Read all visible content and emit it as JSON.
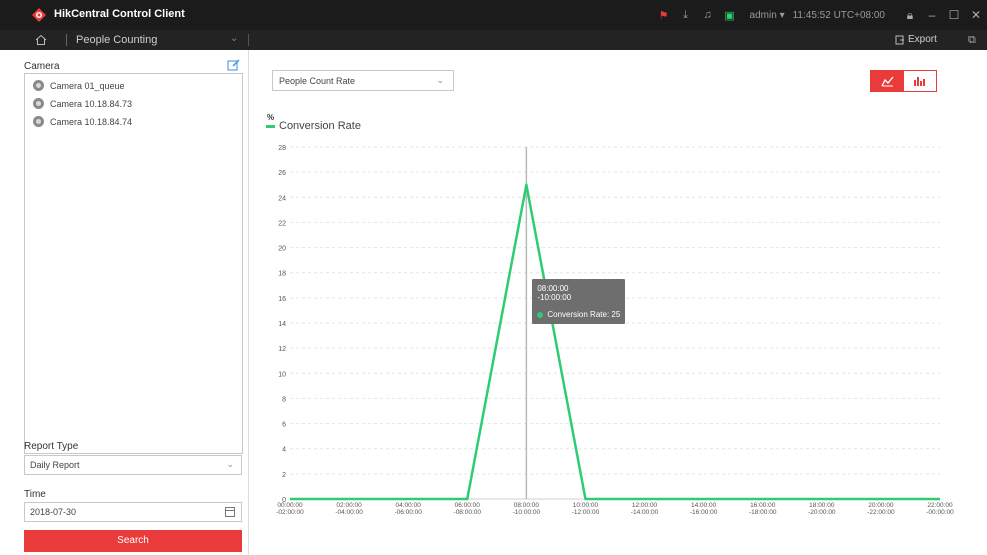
{
  "app": {
    "title": "HikCentral Control Client",
    "user": "admin",
    "time": "11:45:52 UTC+08:00",
    "brand_color": "#e83a3a"
  },
  "nav": {
    "module": "People Counting",
    "export_label": "Export"
  },
  "left": {
    "camera_label": "Camera",
    "cameras": [
      {
        "name": "Camera 01_queue"
      },
      {
        "name": "Camera 10.18.84.73"
      },
      {
        "name": "Camera 10.18.84.74"
      }
    ],
    "report_type_label": "Report Type",
    "report_type_value": "Daily Report",
    "time_label": "Time",
    "time_value": "2018-07-30",
    "search_label": "Search"
  },
  "main": {
    "metric_select_value": "People Count Rate",
    "view_mode": "line"
  },
  "chart_data": {
    "type": "line",
    "ylabel": "%",
    "ylim": [
      0,
      28
    ],
    "yticks": [
      0,
      2,
      4,
      6,
      8,
      10,
      12,
      14,
      16,
      18,
      20,
      22,
      24,
      26,
      28
    ],
    "categories": [
      "00:00:00 -02:00:00",
      "02:00:00 -04:00:00",
      "04:00:00 -06:00:00",
      "06:00:00 -08:00:00",
      "08:00:00 -10:00:00",
      "10:00:00 -12:00:00",
      "12:00:00 -14:00:00",
      "14:00:00 -16:00:00",
      "16:00:00 -18:00:00",
      "18:00:00 -20:00:00",
      "20:00:00 -22:00:00",
      "22:00:00 -00:00:00"
    ],
    "series": [
      {
        "name": "Conversion Rate",
        "color": "#2fcc71",
        "values": [
          0,
          0,
          0,
          0,
          25,
          0,
          0,
          0,
          0,
          0,
          0,
          0
        ]
      }
    ],
    "grid": true,
    "legend": "top-left",
    "tooltip": {
      "line1": "08:00:00",
      "line2": "-10:00:00",
      "series": "Conversion Rate",
      "value": 25
    }
  }
}
